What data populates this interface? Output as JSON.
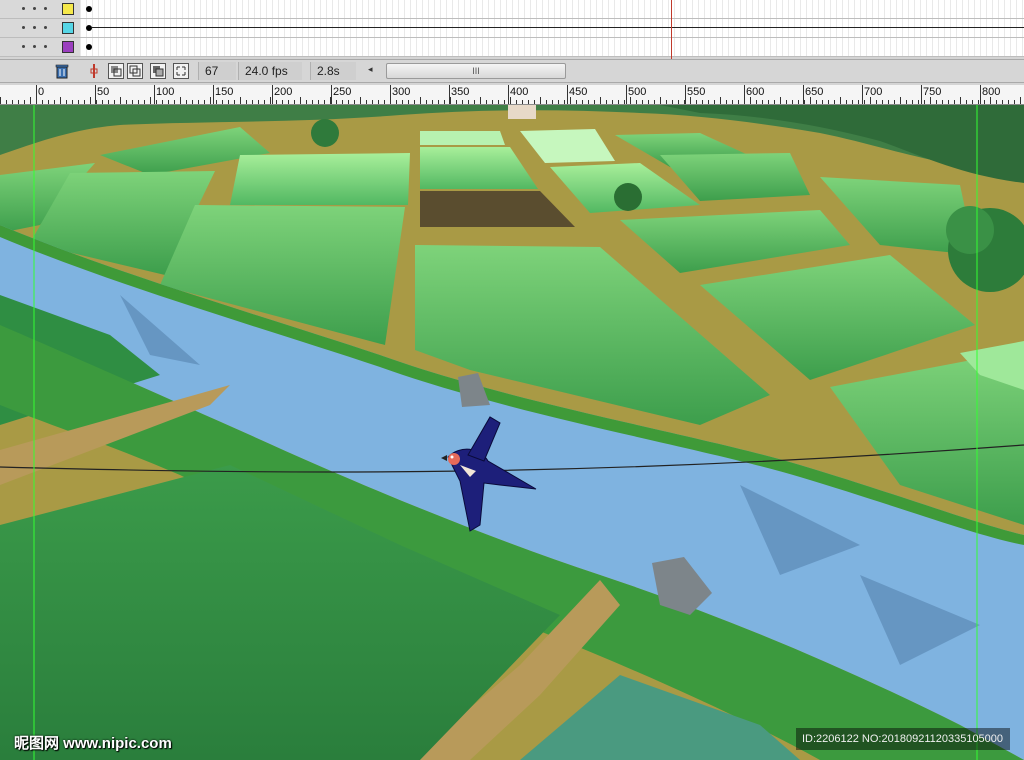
{
  "timeline": {
    "layers": [
      {
        "color": "#f5e84a"
      },
      {
        "color": "#56d6e6"
      },
      {
        "color": "#9b3fbf"
      }
    ],
    "toolbar": {
      "current_frame": "67",
      "frame_rate": "24.0 fps",
      "elapsed_time": "2.8s",
      "scroll_grip": "III",
      "scroll_left_arrow": "◂"
    }
  },
  "ruler": {
    "labels": [
      "0",
      "50",
      "100",
      "150",
      "200",
      "250",
      "300",
      "350",
      "400",
      "450",
      "500",
      "550",
      "600",
      "650",
      "700",
      "750",
      "800"
    ]
  },
  "watermark": {
    "site": "昵图网 www.nipic.com",
    "image_id": "ID:2206122 NO:20180921120335105000"
  },
  "colors": {
    "river": "#7fb3e0",
    "paddy_light": "#5fc06a",
    "paddy_dark": "#2f8e43",
    "dike": "#b8a24a",
    "swallow": "#1d1f7a",
    "guide": "#33ff33"
  },
  "icons": {
    "trash": "trash-icon",
    "onion": "onion-skin-icon",
    "edit": "edit-multiple-frames-icon"
  }
}
